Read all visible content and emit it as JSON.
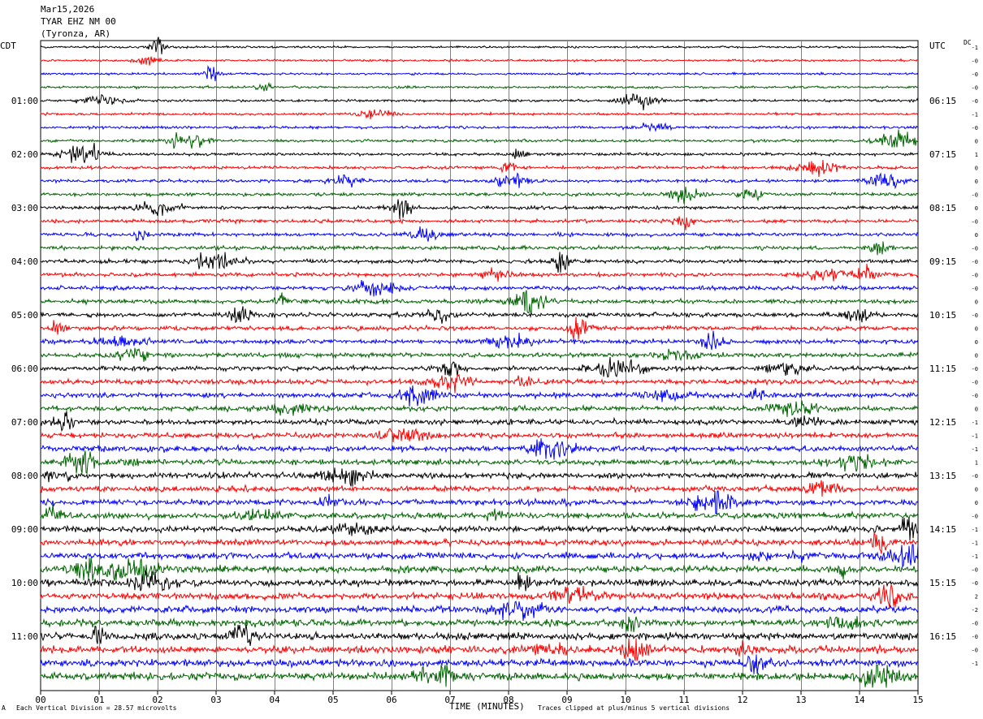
{
  "header": {
    "date": "Mar15,2026",
    "station": "TYAR EHZ NM 00",
    "location": "(Tyronza, AR)"
  },
  "left_tz": "CDT",
  "right_tz": "UTC",
  "dc_label": "DC",
  "footer": {
    "scale_note": "Each Vertical Division =   28.57 microvolts",
    "xaxis_title": "TIME (MINUTES)",
    "clip_note": "Traces clipped at plus/minus 5 vertical divisions",
    "corner_mark": "A"
  },
  "colors": {
    "black": "#000000",
    "red": "#ff0000",
    "blue": "#0000ff",
    "green": "#006400",
    "grid": "#808080"
  },
  "chart_data": {
    "type": "line",
    "description_type": "helicorder seismogram",
    "xlabel": "TIME (MINUTES)",
    "xlim": [
      0,
      15
    ],
    "x_ticks": [
      "00",
      "01",
      "02",
      "03",
      "04",
      "05",
      "06",
      "07",
      "08",
      "09",
      "10",
      "11",
      "12",
      "13",
      "14",
      "15"
    ],
    "row_count": 48,
    "row_color_cycle": [
      "black",
      "red",
      "blue",
      "green"
    ],
    "left_time_labels": [
      {
        "row": 4,
        "label": "01:00"
      },
      {
        "row": 8,
        "label": "02:00"
      },
      {
        "row": 12,
        "label": "03:00"
      },
      {
        "row": 16,
        "label": "04:00"
      },
      {
        "row": 20,
        "label": "05:00"
      },
      {
        "row": 24,
        "label": "06:00"
      },
      {
        "row": 28,
        "label": "07:00"
      },
      {
        "row": 32,
        "label": "08:00"
      },
      {
        "row": 36,
        "label": "09:00"
      },
      {
        "row": 40,
        "label": "10:00"
      },
      {
        "row": 44,
        "label": "11:00"
      }
    ],
    "right_time_labels": [
      {
        "row": 4,
        "label": "06:15"
      },
      {
        "row": 8,
        "label": "07:15"
      },
      {
        "row": 12,
        "label": "08:15"
      },
      {
        "row": 16,
        "label": "09:15"
      },
      {
        "row": 20,
        "label": "10:15"
      },
      {
        "row": 24,
        "label": "11:15"
      },
      {
        "row": 28,
        "label": "12:15"
      },
      {
        "row": 32,
        "label": "13:15"
      },
      {
        "row": 36,
        "label": "14:15"
      },
      {
        "row": 40,
        "label": "15:15"
      },
      {
        "row": 44,
        "label": "16:15"
      }
    ],
    "dc_offsets": [
      "-1",
      "-0",
      "-0",
      "-0",
      "-0",
      "-1",
      "-0",
      "0",
      "1",
      "0",
      "0",
      "-0",
      "0",
      "-0",
      "0",
      "-0",
      "-0",
      "-0",
      "-0",
      "0",
      "-0",
      "0",
      "0",
      "0",
      "-0",
      "-0",
      "-0",
      "0",
      "-1",
      "-1",
      "-1",
      "1",
      "-0",
      "0",
      "0",
      "-0",
      "-1",
      "-1",
      "-1",
      "-0",
      "-0",
      "2",
      "-2",
      "-0",
      "-0",
      "-0",
      "-1"
    ]
  }
}
